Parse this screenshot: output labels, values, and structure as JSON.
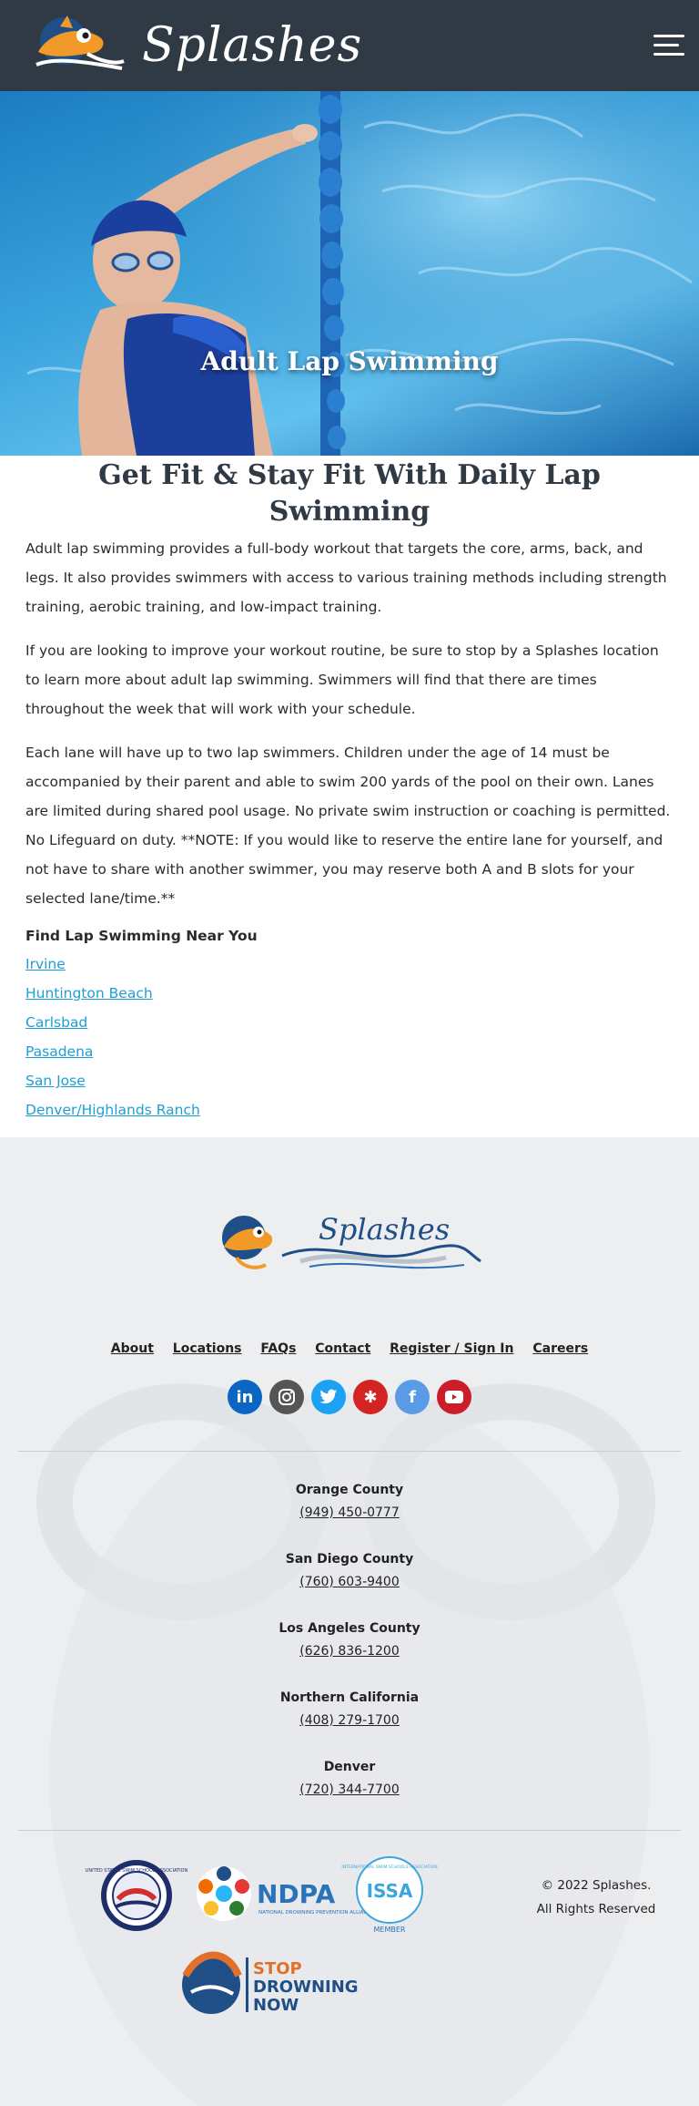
{
  "header": {
    "brand": "Splashes",
    "menu_icon": "hamburger-menu-icon"
  },
  "hero": {
    "title": "Adult Lap Swimming"
  },
  "main": {
    "heading": "Get Fit & Stay Fit With Daily Lap Swimming",
    "paragraphs": [
      "Adult lap swimming provides a full-body workout that targets the core, arms, back, and legs. It also provides swimmers with access to various training methods including strength training, aerobic training, and low-impact training.",
      "If you are looking to improve your workout routine, be sure to stop by a Splashes location to learn more about adult lap swimming. Swimmers will find that there are times throughout the week that will work with your schedule.",
      "Each lane will have up to two lap swimmers. Children under the age of 14 must be accompanied by their parent and able to swim 200 yards of the pool on their own. Lanes are limited during shared pool usage. No private swim instruction or coaching is permitted. No Lifeguard on duty. **NOTE: If you would like to reserve the entire lane for yourself, and not have to share with another swimmer, you may reserve both A and B slots for your selected lane/time.**"
    ],
    "find_title": "Find Lap Swimming Near You",
    "locations": [
      "Irvine",
      "Huntington Beach",
      "Carlsbad",
      "Pasadena",
      "San Jose",
      "Denver/Highlands Ranch"
    ]
  },
  "footer": {
    "logo_text": "Splashes",
    "nav": [
      "About",
      "Locations",
      "FAQs",
      "Contact",
      "Register / Sign In",
      "Careers"
    ],
    "socials": [
      {
        "name": "linkedin-icon",
        "glyph": "in",
        "color": "#0a66c2"
      },
      {
        "name": "instagram-icon",
        "glyph": "◎",
        "color": "#555555"
      },
      {
        "name": "twitter-icon",
        "glyph": "🐦",
        "color": "#1da1f2"
      },
      {
        "name": "yelp-icon",
        "glyph": "✱",
        "color": "#d32323"
      },
      {
        "name": "facebook-icon",
        "glyph": "f",
        "color": "#5a9be6"
      },
      {
        "name": "youtube-icon",
        "glyph": "▶",
        "color": "#cc1d2b"
      }
    ],
    "regions": [
      {
        "name": "Orange County",
        "phone": "(949) 450-0777"
      },
      {
        "name": "San Diego County",
        "phone": "(760) 603-9400"
      },
      {
        "name": "Los Angeles County",
        "phone": "(626) 836-1200"
      },
      {
        "name": "Northern California",
        "phone": "(408) 279-1700"
      },
      {
        "name": "Denver",
        "phone": "(720) 344-7700"
      }
    ],
    "badges": {
      "ussss": "UNITED STATES SWIM SCHOOL ASSOCIATION",
      "ndpa_short": "NDPA",
      "ndpa_long": "NATIONAL DROWNING PREVENTION ALLIANCE",
      "issa_short": "ISSA",
      "issa_long": "INTERNATIONAL SWIM SCHOOLS ASSOCIATION",
      "issa_member": "MEMBER",
      "stop1": "STOP",
      "stop2": "DROWNING",
      "stop3": "NOW"
    },
    "copyright_line1": "© 2022 Splashes.",
    "copyright_line2": "All Rights Reserved"
  },
  "colors": {
    "header_bg": "#2f3a44",
    "link": "#1d9fd6",
    "footer_bg": "#eceef0"
  }
}
